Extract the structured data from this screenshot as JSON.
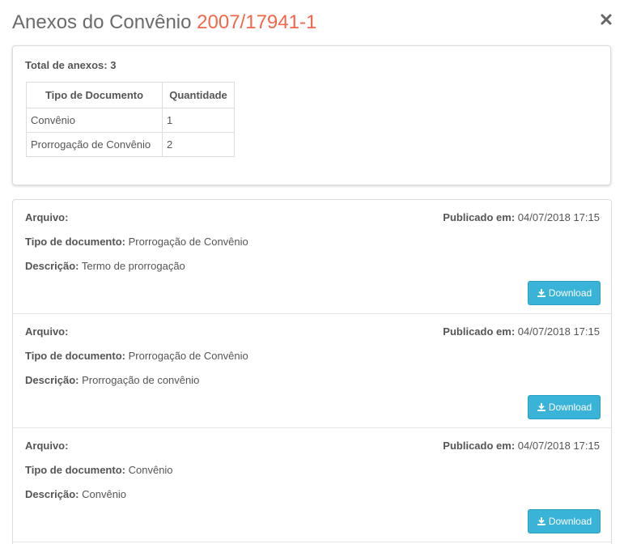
{
  "modal": {
    "title_prefix": "Anexos do Convênio",
    "title_number": "2007/17941-1",
    "close_icon": "close-icon"
  },
  "summary": {
    "total_label": "Total de anexos: 3",
    "headers": [
      "Tipo de Documento",
      "Quantidade"
    ],
    "rows": [
      {
        "type": "Convênio",
        "qty": "1"
      },
      {
        "type": "Prorrogação de Convênio",
        "qty": "2"
      }
    ]
  },
  "labels": {
    "arquivo": "Arquivo:",
    "publicado": "Publicado em:",
    "tipo": "Tipo de documento:",
    "descricao": "Descrição:",
    "download": "Download"
  },
  "files": [
    {
      "arquivo": "",
      "publicado": "04/07/2018 17:15",
      "tipo": "Prorrogação de Convênio",
      "descricao": "Termo de prorrogação"
    },
    {
      "arquivo": "",
      "publicado": "04/07/2018 17:15",
      "tipo": "Prorrogação de Convênio",
      "descricao": "Prorrogação de convênio"
    },
    {
      "arquivo": "",
      "publicado": "04/07/2018 17:15",
      "tipo": "Convênio",
      "descricao": "Convênio"
    }
  ],
  "colors": {
    "accent": "#f2674a",
    "button": "#39b3d7"
  }
}
